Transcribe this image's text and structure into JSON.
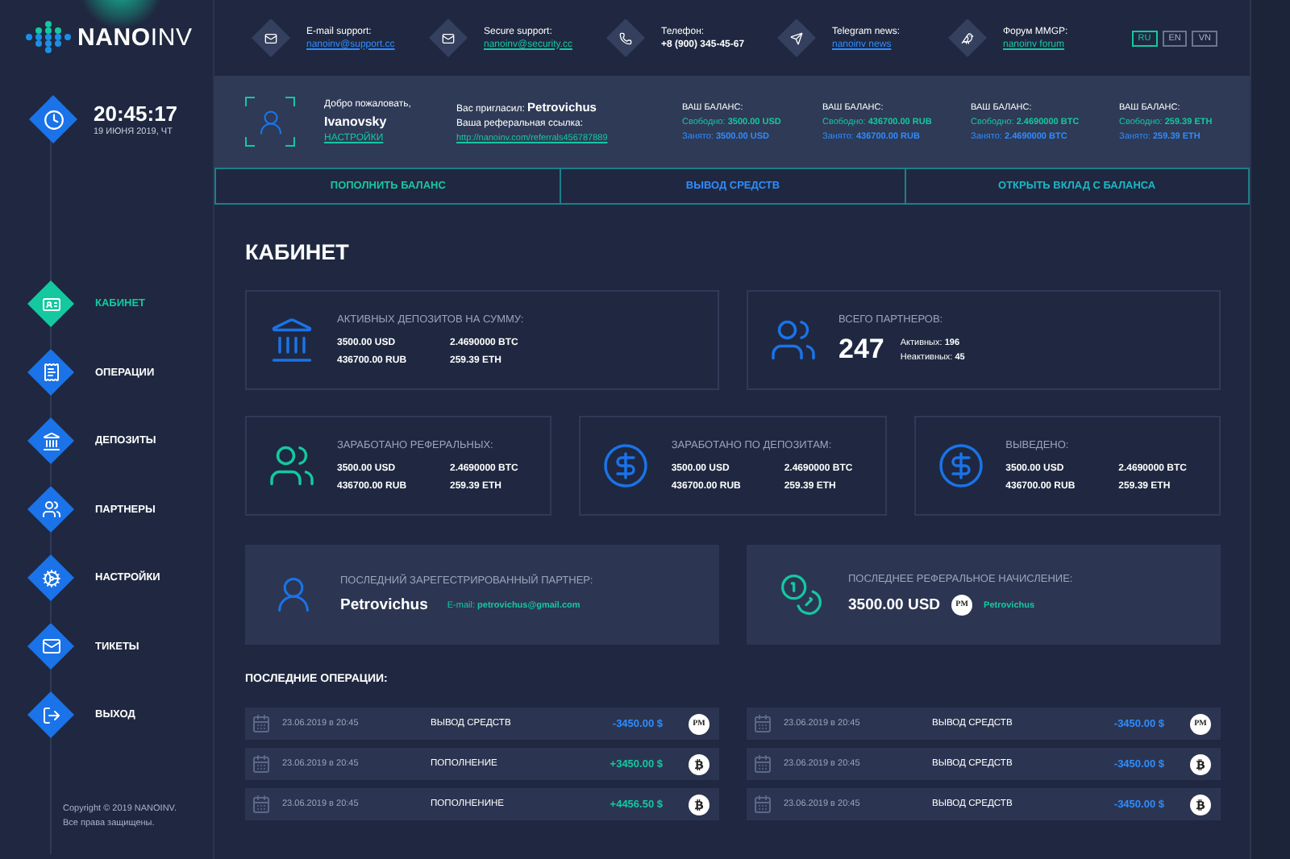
{
  "logo": {
    "bold": "NANO",
    "light": "INV"
  },
  "contacts": [
    {
      "label": "E-mail support:",
      "value": "nanoinv@support.cc",
      "kind": "link",
      "color": "#2f8cff"
    },
    {
      "label": "Secure support:",
      "value": "nanoinv@security.cc",
      "kind": "link",
      "color": "#19c6a0"
    },
    {
      "label": "Телефон:",
      "value": "+8 (900) 345-45-67",
      "kind": "text"
    },
    {
      "label": "Telegram news:",
      "value": "nanoinv news",
      "kind": "link",
      "color": "#2f8cff"
    },
    {
      "label": "Форум MMGP:",
      "value": "nanoinv forum",
      "kind": "link",
      "color": "#19c6a0"
    }
  ],
  "languages": [
    {
      "label": "RU",
      "selected": true
    },
    {
      "label": "EN",
      "selected": false
    },
    {
      "label": "VN",
      "selected": false
    }
  ],
  "clock": {
    "time": "20:45:17",
    "date": "19 ИЮНЯ 2019, ЧТ"
  },
  "menu": [
    {
      "label": "КАБИНЕТ",
      "selected": true
    },
    {
      "label": "ОПЕРАЦИИ",
      "selected": false
    },
    {
      "label": "ДЕПОЗИТЫ",
      "selected": false
    },
    {
      "label": "ПАРТНЕРЫ",
      "selected": false
    },
    {
      "label": "НАСТРОЙКИ",
      "selected": false
    },
    {
      "label": "ТИКЕТЫ",
      "selected": false
    },
    {
      "label": "ВЫХОД",
      "selected": false
    }
  ],
  "copyright": [
    "Copyright © 2019 NANOINV.",
    "Все права защищены."
  ],
  "user": {
    "greeting": "Добро пожаловать,",
    "name": "Ivanovsky",
    "settings": "НАСТРОЙКИ",
    "invited_label": "Вас пригласил:",
    "invited_name": "Petrovichus",
    "ref_label": "Ваша реферальная ссылка:",
    "ref_link": "http://nanoinv.com/referrals456787889"
  },
  "balances": [
    {
      "title": "ВАШ БАЛАНС:",
      "free_label": "Свободно:",
      "free": "3500.00 USD",
      "busy_label": "Занято:",
      "busy": "3500.00 USD"
    },
    {
      "title": "ВАШ БАЛАНС:",
      "free_label": "Свободно:",
      "free": "436700.00 RUB",
      "busy_label": "Занято:",
      "busy": "436700.00 RUB"
    },
    {
      "title": "ВАШ БАЛАНС:",
      "free_label": "Свободно:",
      "free": "2.4690000 BTC",
      "busy_label": "Занято:",
      "busy": "2.4690000 BTC"
    },
    {
      "title": "ВАШ БАЛАНС:",
      "free_label": "Свободно:",
      "free": "259.39 ETH",
      "busy_label": "Занято:",
      "busy": "259.39 ETH"
    }
  ],
  "actions": [
    {
      "label": "ПОПОЛНИТЬ БАЛАНС"
    },
    {
      "label": "ВЫВОД СРЕДСТВ"
    },
    {
      "label": "ОТКРЫТЬ ВКЛАД С БАЛАНСА"
    }
  ],
  "page_title": "КАБИНЕТ",
  "top_cards": [
    {
      "kind": "amounts",
      "title": "АКТИВНЫХ ДЕПОЗИТОВ НА СУММУ:",
      "values": [
        "3500.00 USD",
        "2.4690000 BTC",
        "436700.00 RUB",
        "259.39 ETH"
      ]
    },
    {
      "kind": "partners",
      "title": "ВСЕГО ПАРТНЕРОВ:",
      "total": "247",
      "active_label": "Активных:",
      "active": "196",
      "inactive_label": "Неактивных:",
      "inactive": "45"
    }
  ],
  "middle_cards": [
    {
      "kind": "amounts",
      "title": "ЗАРАБОТАНО РЕФЕРАЛЬНЫХ:",
      "values": [
        "3500.00 USD",
        "2.4690000 BTC",
        "436700.00 RUB",
        "259.39 ETH"
      ]
    },
    {
      "kind": "amounts",
      "title": "ЗАРАБОТАНО ПО ДЕПОЗИТАМ:",
      "values": [
        "3500.00 USD",
        "2.4690000 BTC",
        "436700.00 RUB",
        "259.39 ETH"
      ]
    },
    {
      "kind": "amounts",
      "title": "ВЫВЕДЕНО:",
      "values": [
        "3500.00 USD",
        "2.4690000 BTC",
        "436700.00 RUB",
        "259.39 ETH"
      ]
    }
  ],
  "last_partner": {
    "title": "ПОСЛЕДНИЙ ЗАРЕГЕСТРИРОВАННЫЙ ПАРТНЕР:",
    "name": "Petrovichus",
    "email_label": "E-mail:",
    "email": "petrovichus@gmail.com"
  },
  "last_referral": {
    "title": "ПОСЛЕДНЕЕ РЕФЕРАЛЬНОЕ НАЧИСЛЕНИЕ:",
    "amount": "3500.00 USD",
    "method": "PM",
    "name": "Petrovichus"
  },
  "operations": {
    "title": "ПОСЛЕДНИЕ ОПЕРАЦИИ:",
    "rows": [
      {
        "date": "23.06.2019 в 20:45",
        "type": "ВЫВОД СРЕДСТВ",
        "amount": "-3450.00 $",
        "outgoing": true,
        "kind": "pm",
        "badge": "PM"
      },
      {
        "date": "23.06.2019 в 20:45",
        "type": "ВЫВОД СРЕДСТВ",
        "amount": "-3450.00 $",
        "outgoing": true,
        "kind": "pm",
        "badge": "PM"
      },
      {
        "date": "23.06.2019 в 20:45",
        "type": "ПОПОЛНЕНИЕ",
        "amount": "+3450.00 $",
        "outgoing": false,
        "kind": "btc"
      },
      {
        "date": "23.06.2019 в 20:45",
        "type": "ВЫВОД СРЕДСТВ",
        "amount": "-3450.00 $",
        "outgoing": true,
        "kind": "btc"
      },
      {
        "date": "23.06.2019 в 20:45",
        "type": "ПОПОЛНЕНИНЕ",
        "amount": "+4456.50 $",
        "outgoing": false,
        "kind": "btc"
      },
      {
        "date": "23.06.2019 в 20:45",
        "type": "ВЫВОД СРЕДСТВ",
        "amount": "-3450.00 $",
        "outgoing": true,
        "kind": "btc"
      }
    ]
  }
}
